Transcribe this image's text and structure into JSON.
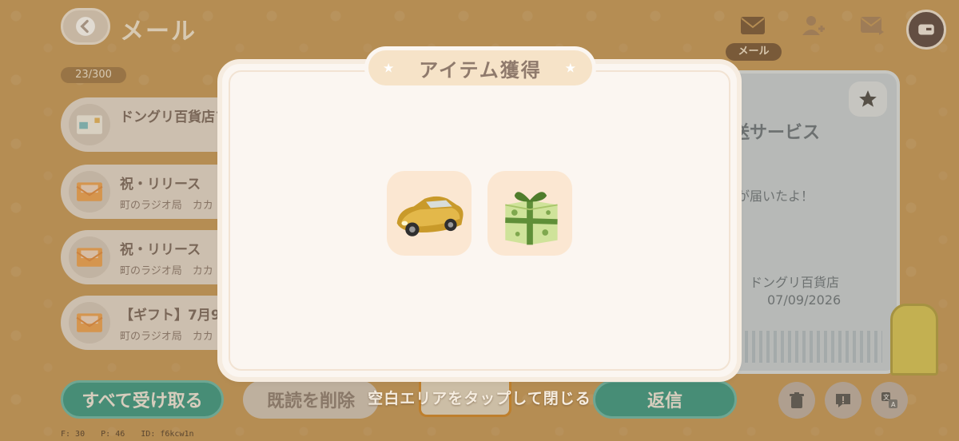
{
  "header": {
    "title": "メール",
    "mail_count": "23/300",
    "mail_tab_label": "メール"
  },
  "mail_list": [
    {
      "title": "ドングリ百貨店フ",
      "sub": ""
    },
    {
      "title": "祝・リリース",
      "sub": "町のラジオ局　カカ"
    },
    {
      "title": "祝・リリース",
      "sub": "町のラジオ局　カカ"
    },
    {
      "title": "【ギフト】7月9",
      "sub": "町のラジオ局　カカ"
    }
  ],
  "detail": {
    "title": "送サービス",
    "body": "が届いたよ！",
    "sender": "ドングリ百貨店",
    "date": "07/09/2026"
  },
  "buttons": {
    "receive_all": "すべて受け取る",
    "delete_read": "既読を削除",
    "reply": "返信"
  },
  "modal": {
    "title": "アイテム獲得",
    "hint": "空白エリアをタップして閉じる",
    "items": [
      {
        "icon": "gold-convertible-car-icon"
      },
      {
        "icon": "green-gift-box-icon"
      }
    ]
  },
  "debug": {
    "f": "F: 30",
    "p": "P: 46",
    "id": "ID: f6kcw1n"
  },
  "colors": {
    "background": "#c79b5d",
    "accent_teal": "#3a9b8a",
    "modal_bg": "#fbf6f1",
    "title_pill": "#f6e3c8"
  }
}
